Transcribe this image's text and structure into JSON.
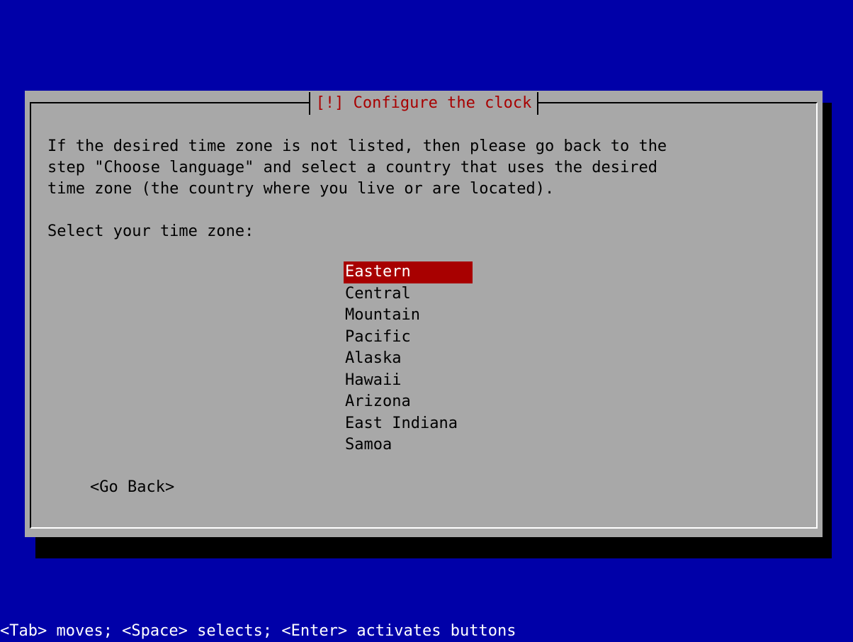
{
  "dialog": {
    "title": "[!] Configure the clock",
    "description": "If the desired time zone is not listed, then please go back to the\nstep \"Choose language\" and select a country that uses the desired\ntime zone (the country where you live or are located).",
    "prompt": "Select your time zone:",
    "timezones": [
      {
        "label": "Eastern",
        "selected": true
      },
      {
        "label": "Central",
        "selected": false
      },
      {
        "label": "Mountain",
        "selected": false
      },
      {
        "label": "Pacific",
        "selected": false
      },
      {
        "label": "Alaska",
        "selected": false
      },
      {
        "label": "Hawaii",
        "selected": false
      },
      {
        "label": "Arizona",
        "selected": false
      },
      {
        "label": "East Indiana",
        "selected": false
      },
      {
        "label": "Samoa",
        "selected": false
      }
    ],
    "go_back_label": "<Go Back>"
  },
  "footer": {
    "help_text": "<Tab> moves; <Space> selects; <Enter> activates buttons"
  },
  "colors": {
    "background": "#0000a8",
    "dialog": "#a8a8a8",
    "title": "#a80000",
    "selection": "#a80000",
    "help_text": "#ffffff"
  }
}
